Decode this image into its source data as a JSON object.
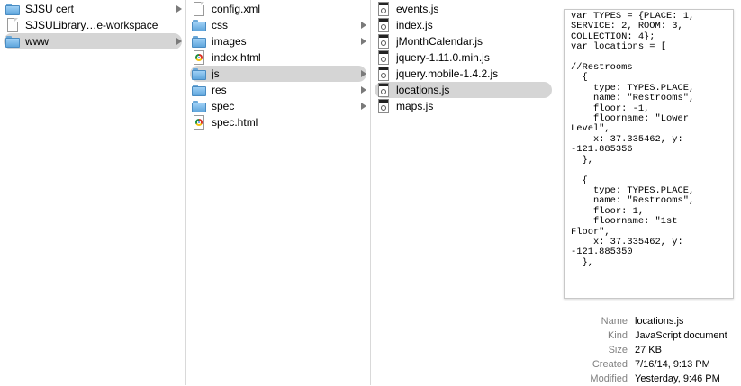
{
  "column1": {
    "items": [
      {
        "label": "SJSU cert",
        "icon": "folder-icon",
        "has_arrow": true
      },
      {
        "label": "SJSULibrary…e-workspace",
        "icon": "document-icon",
        "has_arrow": false
      },
      {
        "label": "www",
        "icon": "folder-icon",
        "has_arrow": true,
        "selected": true
      }
    ]
  },
  "column2": {
    "items": [
      {
        "label": "config.xml",
        "icon": "document-icon"
      },
      {
        "label": "css",
        "icon": "folder-icon"
      },
      {
        "label": "images",
        "icon": "folder-icon"
      },
      {
        "label": "index.html",
        "icon": "html-file-icon"
      },
      {
        "label": "js",
        "icon": "folder-icon",
        "selected": true
      },
      {
        "label": "res",
        "icon": "folder-icon"
      },
      {
        "label": "spec",
        "icon": "folder-icon"
      },
      {
        "label": "spec.html",
        "icon": "html-file-icon"
      }
    ]
  },
  "column3": {
    "items": [
      {
        "label": "events.js",
        "icon": "js-file-icon"
      },
      {
        "label": "index.js",
        "icon": "js-file-icon"
      },
      {
        "label": "jMonthCalendar.js",
        "icon": "js-file-icon"
      },
      {
        "label": "jquery-1.11.0.min.js",
        "icon": "js-file-icon"
      },
      {
        "label": "jquery.mobile-1.4.2.js",
        "icon": "js-file-icon"
      },
      {
        "label": "locations.js",
        "icon": "js-file-icon",
        "selected": true
      },
      {
        "label": "maps.js",
        "icon": "js-file-icon"
      }
    ]
  },
  "preview": {
    "code": "var TYPES = {PLACE: 1,\nSERVICE: 2, ROOM: 3,\nCOLLECTION: 4};\nvar locations = [\n\n//Restrooms\n  {\n    type: TYPES.PLACE,\n    name: \"Restrooms\",\n    floor: -1,\n    floorname: \"Lower\nLevel\",\n    x: 37.335462, y:\n-121.885356\n  },\n\n  {\n    type: TYPES.PLACE,\n    name: \"Restrooms\",\n    floor: 1,\n    floorname: \"1st\nFloor\",\n    x: 37.335462, y:\n-121.885350\n  },"
  },
  "info": {
    "name_label": "Name",
    "name_value": "locations.js",
    "kind_label": "Kind",
    "kind_value": "JavaScript document",
    "size_label": "Size",
    "size_value": "27 KB",
    "created_label": "Created",
    "created_value": "7/16/14, 9:13 PM",
    "modified_label": "Modified",
    "modified_value": "Yesterday, 9:46 PM"
  },
  "colors": {
    "selection": "#d5d5d5",
    "folder": "#6fb0e6",
    "divider": "#d9d9d9"
  }
}
